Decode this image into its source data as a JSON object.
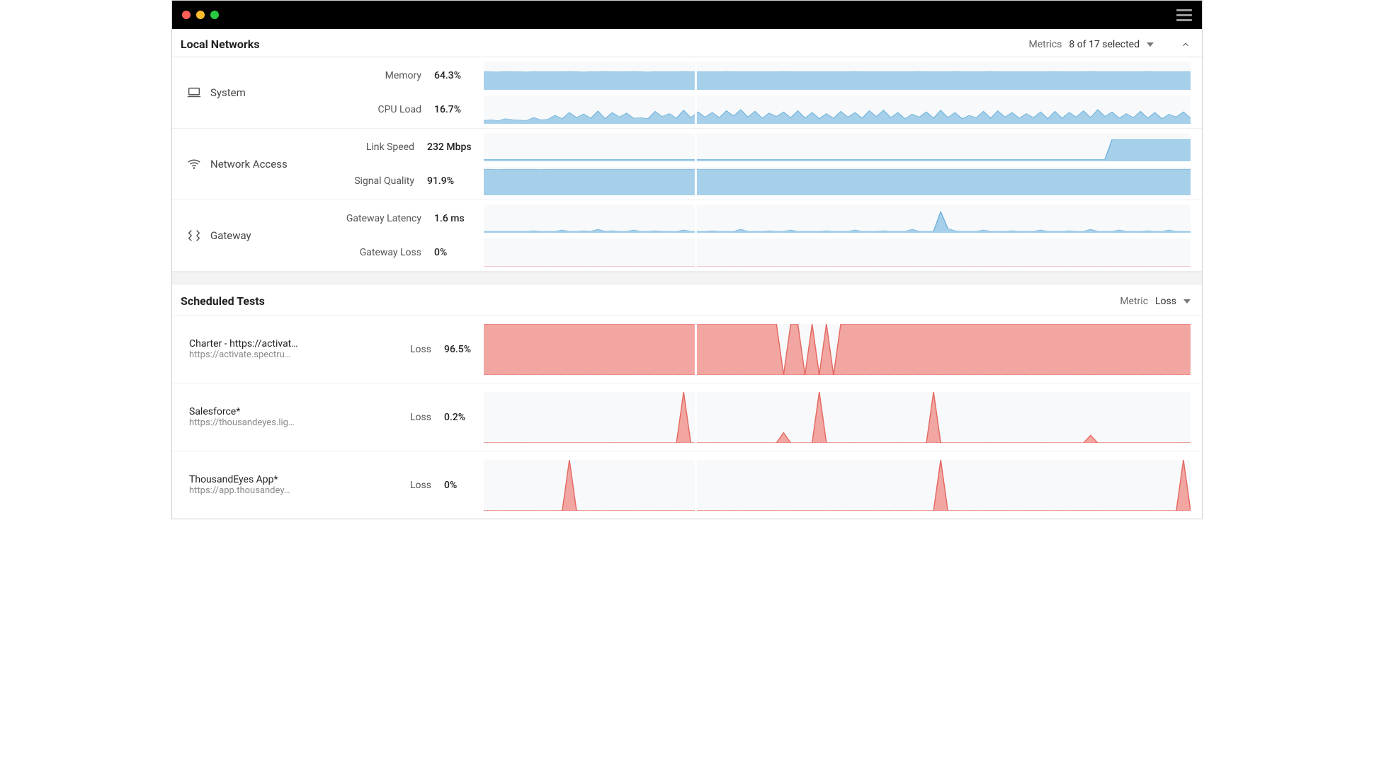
{
  "colors": {
    "blue_fill": "#a6cfe9",
    "blue_stroke": "#6fb3dd",
    "red_fill": "#f2a6a2",
    "red_stroke": "#e46a63"
  },
  "header": {
    "local_networks_title": "Local Networks",
    "metrics_label": "Metrics",
    "metrics_value": "8 of 17 selected"
  },
  "groups": {
    "system": {
      "label": "System",
      "memory": {
        "label": "Memory",
        "value": "64.3%"
      },
      "cpu": {
        "label": "CPU Load",
        "value": "16.7%"
      }
    },
    "network_access": {
      "label": "Network Access",
      "link_speed": {
        "label": "Link Speed",
        "value": "232 Mbps"
      },
      "signal": {
        "label": "Signal Quality",
        "value": "91.9%"
      }
    },
    "gateway": {
      "label": "Gateway",
      "latency": {
        "label": "Gateway Latency",
        "value": "1.6 ms"
      },
      "loss": {
        "label": "Gateway Loss",
        "value": "0%"
      }
    }
  },
  "scheduled": {
    "title": "Scheduled Tests",
    "metric_label": "Metric",
    "metric_value": "Loss",
    "rows": [
      {
        "title": "Charter - https://activat…",
        "subtitle": "https://activate.spectru…",
        "label": "Loss",
        "value": "96.5%"
      },
      {
        "title": "Salesforce*",
        "subtitle": "https://thousandeyes.lig…",
        "label": "Loss",
        "value": "0.2%"
      },
      {
        "title": "ThousandEyes App*",
        "subtitle": "https://app.thousandey…",
        "label": "Loss",
        "value": "0%"
      }
    ]
  },
  "chart_data": [
    {
      "type": "area",
      "name": "system_memory",
      "ylim": [
        0,
        100
      ],
      "unit": "%",
      "approx_mean": 64.3,
      "x": "time (min 0-100)",
      "values_desc": "near-flat band ~62-66%",
      "values": [
        64,
        64,
        63,
        65,
        64,
        64,
        63,
        65,
        64,
        64,
        64,
        64,
        65,
        64,
        63,
        64,
        64,
        65,
        64,
        64,
        64,
        65,
        64,
        63,
        64,
        64,
        64,
        64,
        65,
        64,
        64,
        64,
        64,
        64,
        65,
        64,
        64,
        64,
        64,
        64,
        64,
        64,
        65,
        64,
        64,
        64,
        64,
        64,
        64,
        64,
        64,
        64,
        65,
        64,
        64,
        64,
        64,
        64,
        64,
        64,
        64,
        65,
        64,
        64,
        64,
        64,
        65,
        64,
        64,
        64,
        64,
        65,
        64,
        64,
        64,
        64,
        64,
        64,
        64,
        64,
        65,
        64,
        64,
        64,
        64,
        65,
        64,
        64,
        64,
        64,
        64,
        64,
        64,
        65,
        64,
        64,
        64,
        64,
        64,
        64
      ]
    },
    {
      "type": "area",
      "name": "system_cpu",
      "ylim": [
        0,
        100
      ],
      "unit": "%",
      "approx_mean": 16.7,
      "values_desc": "bursty spikes 10-60%",
      "values": [
        12,
        14,
        11,
        18,
        15,
        13,
        12,
        22,
        14,
        16,
        30,
        18,
        40,
        22,
        35,
        20,
        45,
        18,
        40,
        24,
        38,
        20,
        22,
        18,
        44,
        26,
        36,
        20,
        48,
        22,
        42,
        24,
        40,
        22,
        46,
        28,
        50,
        24,
        44,
        20,
        38,
        26,
        42,
        22,
        46,
        20,
        40,
        18,
        36,
        20,
        44,
        24,
        40,
        20,
        46,
        26,
        48,
        22,
        40,
        18,
        34,
        24,
        42,
        20,
        48,
        22,
        40,
        18,
        30,
        22,
        44,
        20,
        46,
        24,
        40,
        20,
        36,
        22,
        42,
        18,
        44,
        20,
        40,
        24,
        46,
        22,
        50,
        26,
        42,
        20,
        36,
        22,
        44,
        20,
        40,
        18,
        34,
        24,
        42,
        20
      ]
    },
    {
      "type": "area",
      "name": "link_speed",
      "ylim": [
        0,
        300
      ],
      "unit": "Mbps",
      "approx_mean": 232,
      "values_desc": "flat low band ~20 then step up to ~230 near end",
      "values": [
        20,
        20,
        20,
        20,
        20,
        20,
        20,
        20,
        20,
        20,
        20,
        20,
        20,
        20,
        20,
        20,
        20,
        20,
        20,
        20,
        20,
        20,
        20,
        20,
        20,
        20,
        20,
        20,
        20,
        20,
        20,
        20,
        20,
        20,
        20,
        20,
        20,
        20,
        20,
        20,
        20,
        20,
        20,
        20,
        20,
        20,
        20,
        20,
        20,
        20,
        20,
        20,
        20,
        20,
        20,
        20,
        20,
        20,
        20,
        20,
        20,
        20,
        20,
        20,
        20,
        20,
        20,
        20,
        20,
        20,
        20,
        20,
        20,
        20,
        20,
        20,
        20,
        20,
        20,
        20,
        20,
        20,
        20,
        20,
        20,
        20,
        20,
        20,
        230,
        230,
        230,
        230,
        230,
        230,
        230,
        230,
        230,
        230,
        230,
        230
      ]
    },
    {
      "type": "area",
      "name": "signal_quality",
      "ylim": [
        0,
        100
      ],
      "unit": "%",
      "approx_mean": 91.9,
      "values_desc": "near-flat ~90-94%",
      "values": [
        92,
        92,
        91,
        92,
        92,
        92,
        92,
        92,
        91,
        92,
        92,
        92,
        92,
        92,
        92,
        92,
        92,
        92,
        92,
        92,
        92,
        92,
        92,
        92,
        92,
        92,
        92,
        92,
        92,
        92,
        92,
        92,
        92,
        92,
        92,
        92,
        92,
        92,
        92,
        92,
        92,
        92,
        92,
        92,
        92,
        92,
        92,
        92,
        92,
        92,
        92,
        92,
        92,
        92,
        92,
        92,
        92,
        92,
        92,
        92,
        92,
        92,
        92,
        92,
        92,
        92,
        92,
        92,
        92,
        92,
        92,
        92,
        92,
        92,
        92,
        92,
        92,
        92,
        92,
        92,
        92,
        92,
        92,
        92,
        92,
        92,
        92,
        92,
        92,
        92,
        92,
        92,
        92,
        92,
        92,
        92,
        92,
        92,
        92,
        92
      ]
    },
    {
      "type": "line",
      "name": "gateway_latency",
      "ylim": [
        0,
        40
      ],
      "unit": "ms",
      "approx_mean": 1.6,
      "values_desc": "baseline ~2ms with small bumps, one big spike ~30ms",
      "values": [
        2,
        2,
        2,
        2,
        2,
        2,
        2,
        3,
        2,
        2,
        2,
        4,
        2,
        2,
        3,
        2,
        5,
        2,
        3,
        2,
        2,
        4,
        2,
        2,
        3,
        2,
        2,
        2,
        4,
        2,
        2,
        2,
        3,
        2,
        2,
        2,
        5,
        2,
        2,
        2,
        3,
        2,
        2,
        4,
        2,
        2,
        2,
        2,
        3,
        2,
        2,
        2,
        4,
        2,
        2,
        2,
        3,
        2,
        2,
        2,
        5,
        2,
        2,
        2,
        30,
        6,
        3,
        2,
        2,
        2,
        4,
        2,
        2,
        2,
        3,
        2,
        2,
        2,
        4,
        2,
        2,
        2,
        3,
        2,
        2,
        5,
        2,
        2,
        2,
        4,
        2,
        2,
        2,
        3,
        2,
        2,
        4,
        2,
        2,
        2
      ]
    },
    {
      "type": "line",
      "name": "gateway_loss",
      "ylim": [
        0,
        100
      ],
      "unit": "%",
      "approx_mean": 0,
      "values_desc": "flat zero",
      "values": [
        0,
        0,
        0,
        0,
        0,
        0,
        0,
        0,
        0,
        0,
        0,
        0,
        0,
        0,
        0,
        0,
        0,
        0,
        0,
        0,
        0,
        0,
        0,
        0,
        0,
        0,
        0,
        0,
        0,
        0,
        0,
        0,
        0,
        0,
        0,
        0,
        0,
        0,
        0,
        0,
        0,
        0,
        0,
        0,
        0,
        0,
        0,
        0,
        0,
        0,
        0,
        0,
        0,
        0,
        0,
        0,
        0,
        0,
        0,
        0,
        0,
        0,
        0,
        0,
        0,
        0,
        0,
        0,
        0,
        0,
        0,
        0,
        0,
        0,
        0,
        0,
        0,
        0,
        0,
        0,
        0,
        0,
        0,
        0,
        0,
        0,
        0,
        0,
        0,
        0,
        0,
        0,
        0,
        0,
        0,
        0,
        0,
        0,
        0,
        0
      ]
    },
    {
      "type": "area",
      "name": "loss_charter",
      "ylim": [
        0,
        100
      ],
      "unit": "%",
      "approx_mean": 96.5,
      "values_desc": "full 100% with a few 0% dips mid-series",
      "values": [
        100,
        100,
        100,
        100,
        100,
        100,
        100,
        100,
        100,
        100,
        100,
        100,
        100,
        100,
        100,
        100,
        100,
        100,
        100,
        100,
        100,
        100,
        100,
        100,
        100,
        100,
        100,
        100,
        100,
        100,
        100,
        100,
        100,
        100,
        100,
        100,
        100,
        100,
        100,
        100,
        100,
        100,
        0,
        100,
        100,
        0,
        100,
        0,
        100,
        0,
        100,
        100,
        100,
        100,
        100,
        100,
        100,
        100,
        100,
        100,
        100,
        100,
        100,
        100,
        100,
        100,
        100,
        100,
        100,
        100,
        100,
        100,
        100,
        100,
        100,
        100,
        100,
        100,
        100,
        100,
        100,
        100,
        100,
        100,
        100,
        100,
        100,
        100,
        100,
        100,
        100,
        100,
        100,
        100,
        100,
        100,
        100,
        100,
        100,
        100
      ]
    },
    {
      "type": "area",
      "name": "loss_salesforce",
      "ylim": [
        0,
        100
      ],
      "unit": "%",
      "approx_mean": 0.2,
      "values_desc": "zero baseline with a few 100% spikes",
      "values": [
        0,
        0,
        0,
        0,
        0,
        0,
        0,
        0,
        0,
        0,
        0,
        0,
        0,
        0,
        0,
        0,
        0,
        0,
        0,
        0,
        0,
        0,
        0,
        0,
        0,
        0,
        0,
        0,
        100,
        0,
        0,
        0,
        0,
        0,
        0,
        0,
        0,
        0,
        0,
        0,
        0,
        0,
        20,
        0,
        0,
        0,
        0,
        100,
        0,
        0,
        0,
        0,
        0,
        0,
        0,
        0,
        0,
        0,
        0,
        0,
        0,
        0,
        0,
        100,
        0,
        0,
        0,
        0,
        0,
        0,
        0,
        0,
        0,
        0,
        0,
        0,
        0,
        0,
        0,
        0,
        0,
        0,
        0,
        0,
        0,
        15,
        0,
        0,
        0,
        0,
        0,
        0,
        0,
        0,
        0,
        0,
        0,
        0,
        0,
        0
      ]
    },
    {
      "type": "area",
      "name": "loss_thousandeyes",
      "ylim": [
        0,
        100
      ],
      "unit": "%",
      "approx_mean": 0,
      "values_desc": "zero baseline with 3 narrow 100% spikes",
      "values": [
        0,
        0,
        0,
        0,
        0,
        0,
        0,
        0,
        0,
        0,
        0,
        0,
        100,
        0,
        0,
        0,
        0,
        0,
        0,
        0,
        0,
        0,
        0,
        0,
        0,
        0,
        0,
        0,
        0,
        0,
        0,
        0,
        0,
        0,
        0,
        0,
        0,
        0,
        0,
        0,
        0,
        0,
        0,
        0,
        0,
        0,
        0,
        0,
        0,
        0,
        0,
        0,
        0,
        0,
        0,
        0,
        0,
        0,
        0,
        0,
        0,
        0,
        0,
        0,
        100,
        0,
        0,
        0,
        0,
        0,
        0,
        0,
        0,
        0,
        0,
        0,
        0,
        0,
        0,
        0,
        0,
        0,
        0,
        0,
        0,
        0,
        0,
        0,
        0,
        0,
        0,
        0,
        0,
        0,
        0,
        0,
        0,
        0,
        100,
        0
      ]
    }
  ]
}
